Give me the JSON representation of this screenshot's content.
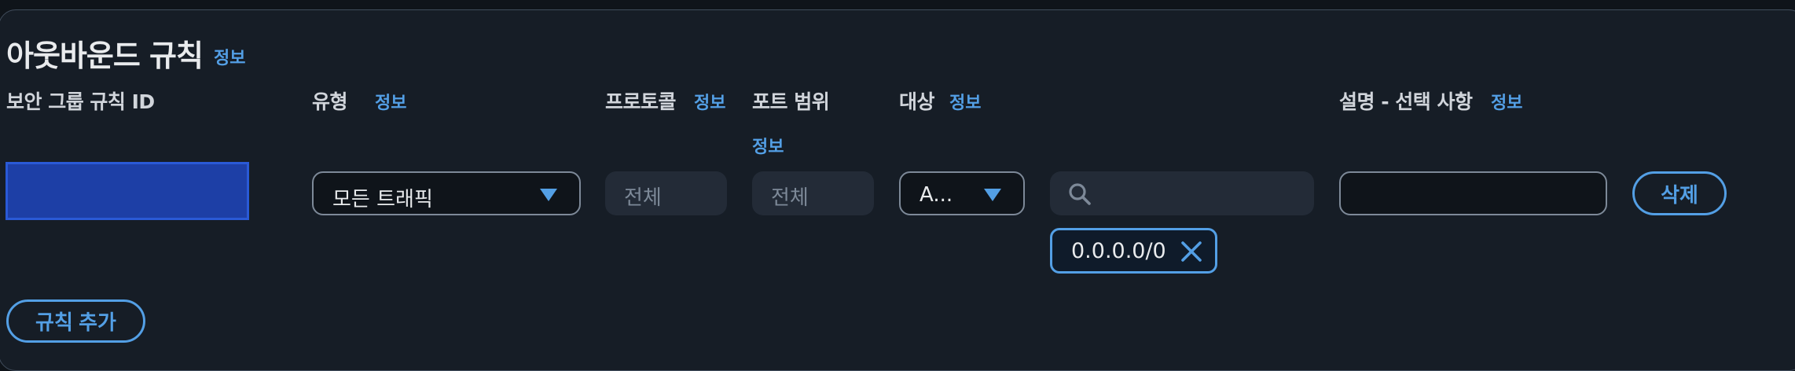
{
  "section": {
    "title": "아웃바운드 규칙",
    "title_info": "정보"
  },
  "columns": {
    "rule_id": {
      "label": "보안 그룹 규칙 ID"
    },
    "type": {
      "label": "유형",
      "info": "정보"
    },
    "protocol": {
      "label": "프로토콜",
      "info": "정보"
    },
    "port_range": {
      "label": "포트 범위",
      "info": "정보"
    },
    "destination": {
      "label": "대상",
      "info": "정보"
    },
    "description": {
      "label": "설명 - 선택 사항",
      "info": "정보"
    }
  },
  "rule": {
    "rule_id_value": "",
    "type_value": "모든 트래픽",
    "protocol_value": "전체",
    "port_range_value": "전체",
    "destination_type_value": "A...",
    "destination_search_value": "",
    "destination_token": "0.0.0.0/0",
    "description_value": "",
    "delete_label": "삭제"
  },
  "add_rule_label": "규칙 추가",
  "colors": {
    "background": "#161d26",
    "accent": "#539fe5",
    "selected_fill": "#1d3fa6"
  },
  "icons": [
    "caret-down-icon",
    "search-icon",
    "close-icon"
  ]
}
